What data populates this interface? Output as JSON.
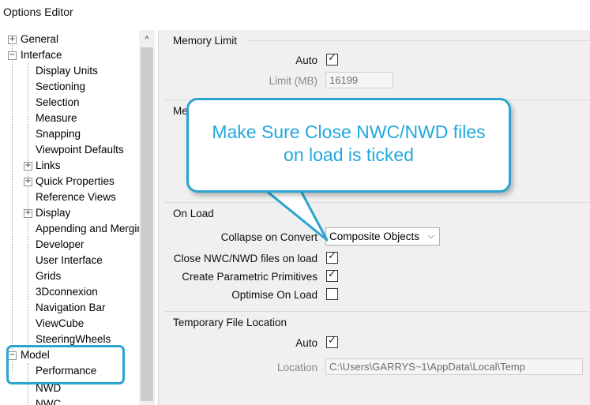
{
  "window": {
    "title": "Options Editor"
  },
  "tree": {
    "items": [
      {
        "label": "General",
        "expander": "+"
      },
      {
        "label": "Interface",
        "expander": "−"
      },
      {
        "label": "Display Units"
      },
      {
        "label": "Sectioning"
      },
      {
        "label": "Selection"
      },
      {
        "label": "Measure"
      },
      {
        "label": "Snapping"
      },
      {
        "label": "Viewpoint Defaults"
      },
      {
        "label": "Links",
        "expander": "+"
      },
      {
        "label": "Quick Properties",
        "expander": "+"
      },
      {
        "label": "Reference Views"
      },
      {
        "label": "Display",
        "expander": "+"
      },
      {
        "label": "Appending and Merging"
      },
      {
        "label": "Developer"
      },
      {
        "label": "User Interface"
      },
      {
        "label": "Grids"
      },
      {
        "label": "3Dconnexion"
      },
      {
        "label": "Navigation Bar"
      },
      {
        "label": "ViewCube"
      },
      {
        "label": "SteeringWheels"
      },
      {
        "label": "Model",
        "expander": "−"
      },
      {
        "label": "Performance",
        "selected": true
      },
      {
        "label": "NWD"
      },
      {
        "label": "NWC"
      }
    ]
  },
  "memory_limit": {
    "title": "Memory Limit",
    "auto_label": "Auto",
    "auto_checked": true,
    "limit_label": "Limit (MB)",
    "limit_value": "16199"
  },
  "merge_group": {
    "title_visible": "Me"
  },
  "on_load": {
    "title": "On Load",
    "collapse_label": "Collapse on Convert",
    "collapse_value": "Composite Objects",
    "close_files_label": "Close NWC/NWD files on load",
    "close_files_checked": true,
    "parametric_label": "Create Parametric Primitives",
    "parametric_checked": true,
    "optimise_label": "Optimise On Load",
    "optimise_checked": false
  },
  "temp_location": {
    "title": "Temporary File Location",
    "auto_label": "Auto",
    "auto_checked": true,
    "location_label": "Location",
    "location_value": "C:\\Users\\GARRYS~1\\AppData\\Local\\Temp"
  },
  "annotation": {
    "callout_line1": "Make Sure Close NWC/NWD files",
    "callout_line2": "on load is ticked",
    "color": "#2aa4d0"
  },
  "icons": {
    "tick": "✓",
    "scroll_up": "^",
    "dropdown": "⌵"
  }
}
